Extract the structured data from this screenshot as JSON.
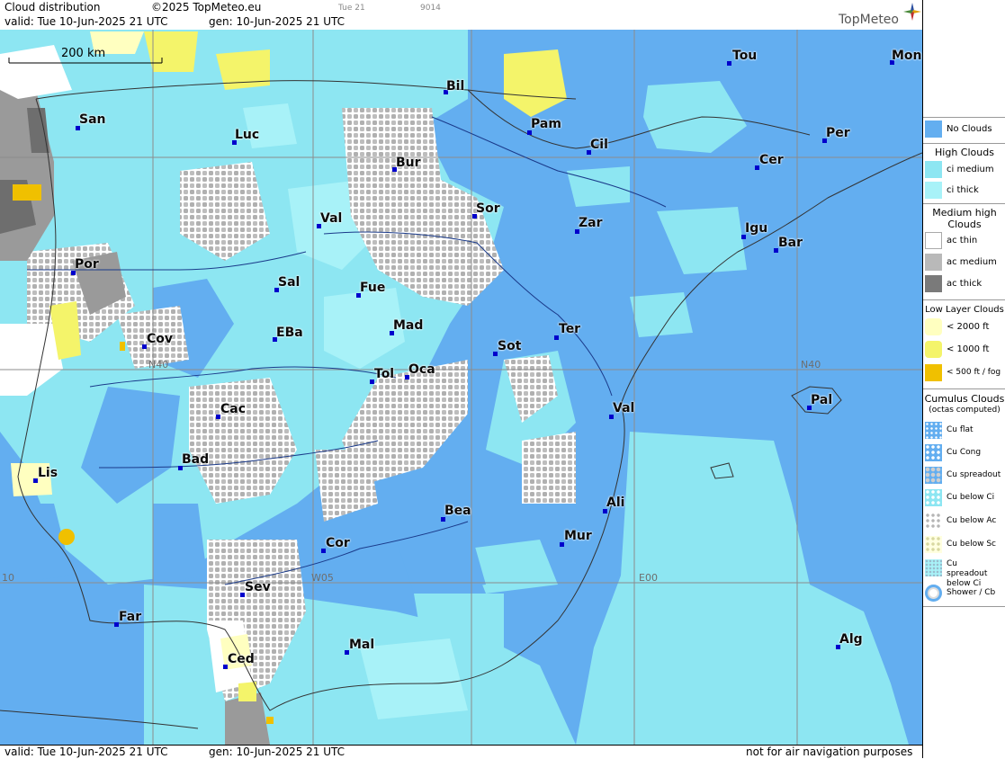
{
  "header": {
    "title": "Cloud distribution",
    "copyright": "©2025 TopMeteo.eu",
    "valid": "valid:  Tue  10-Jun-2025  21 UTC",
    "gen": "gen: 10-Jun-2025  21 UTC",
    "time_small": "Tue 21",
    "code_small": "9014",
    "logo": "TopMeteo"
  },
  "footer": {
    "valid": "valid:  Tue  10-Jun-2025  21 UTC",
    "gen": "gen: 10-Jun-2025  21 UTC",
    "note": "not for air navigation purposes"
  },
  "map": {
    "scale_label": "200 km",
    "grid_labels": [
      "N40",
      "N40",
      "W05",
      "E00",
      "10"
    ],
    "colors": {
      "no_clouds": "#63aef0",
      "ci_medium": "#8de6f2",
      "ci_thick": "#a8f2f8",
      "ac_thin": "#ffffff",
      "ac_medium": "#b9b9b9",
      "ac_thick": "#7a7a7a",
      "low_2000": "#ffffc0",
      "low_1000": "#f4f46a",
      "low_500": "#f0c000",
      "coast": "#333333",
      "river": "#1a3a8a",
      "city_dot": "#0000cc"
    },
    "cities": [
      {
        "name": "Bil"
      },
      {
        "name": "Pam"
      },
      {
        "name": "Tou"
      },
      {
        "name": "Mon"
      },
      {
        "name": "San"
      },
      {
        "name": "Luc"
      },
      {
        "name": "Cil"
      },
      {
        "name": "Per"
      },
      {
        "name": "Bur"
      },
      {
        "name": "Cer"
      },
      {
        "name": "Sor"
      },
      {
        "name": "Val"
      },
      {
        "name": "Zar"
      },
      {
        "name": "Igu"
      },
      {
        "name": "Bar"
      },
      {
        "name": "Por"
      },
      {
        "name": "Sal"
      },
      {
        "name": "Fue"
      },
      {
        "name": "Mad"
      },
      {
        "name": "Cov"
      },
      {
        "name": "EBa"
      },
      {
        "name": "Sot"
      },
      {
        "name": "Ter"
      },
      {
        "name": "Tol"
      },
      {
        "name": "Oca"
      },
      {
        "name": "Pal"
      },
      {
        "name": "Cac"
      },
      {
        "name": "Val"
      },
      {
        "name": "Bad"
      },
      {
        "name": "Lis"
      },
      {
        "name": "Ali"
      },
      {
        "name": "Bea"
      },
      {
        "name": "Mur"
      },
      {
        "name": "Cor"
      },
      {
        "name": "Sev"
      },
      {
        "name": "Far"
      },
      {
        "name": "Alg"
      },
      {
        "name": "Mal"
      },
      {
        "name": "Ced"
      }
    ]
  },
  "legend": {
    "no_clouds": "No Clouds",
    "high_clouds": "High Clouds",
    "ci_medium": "ci medium",
    "ci_thick": "ci thick",
    "medium_high": "Medium high Clouds",
    "ac_thin": "ac thin",
    "ac_medium": "ac medium",
    "ac_thick": "ac thick",
    "low_layer": "Low Layer Clouds",
    "low_2000": "< 2000 ft",
    "low_1000": "< 1000 ft",
    "low_500": "< 500 ft / fog",
    "cumulus": "Cumulus Clouds",
    "cumulus_sub": "(octas computed)",
    "cu_flat": "Cu flat",
    "cu_cong": "Cu Cong",
    "cu_spreadout": "Cu spreadout",
    "cu_below_ci": "Cu below Ci",
    "cu_below_ac": "Cu below Ac",
    "cu_below_sc": "Cu below Sc",
    "cu_spreadout_below_ci": "Cu spreadout below Ci",
    "shower_cb": "Shower / Cb"
  }
}
